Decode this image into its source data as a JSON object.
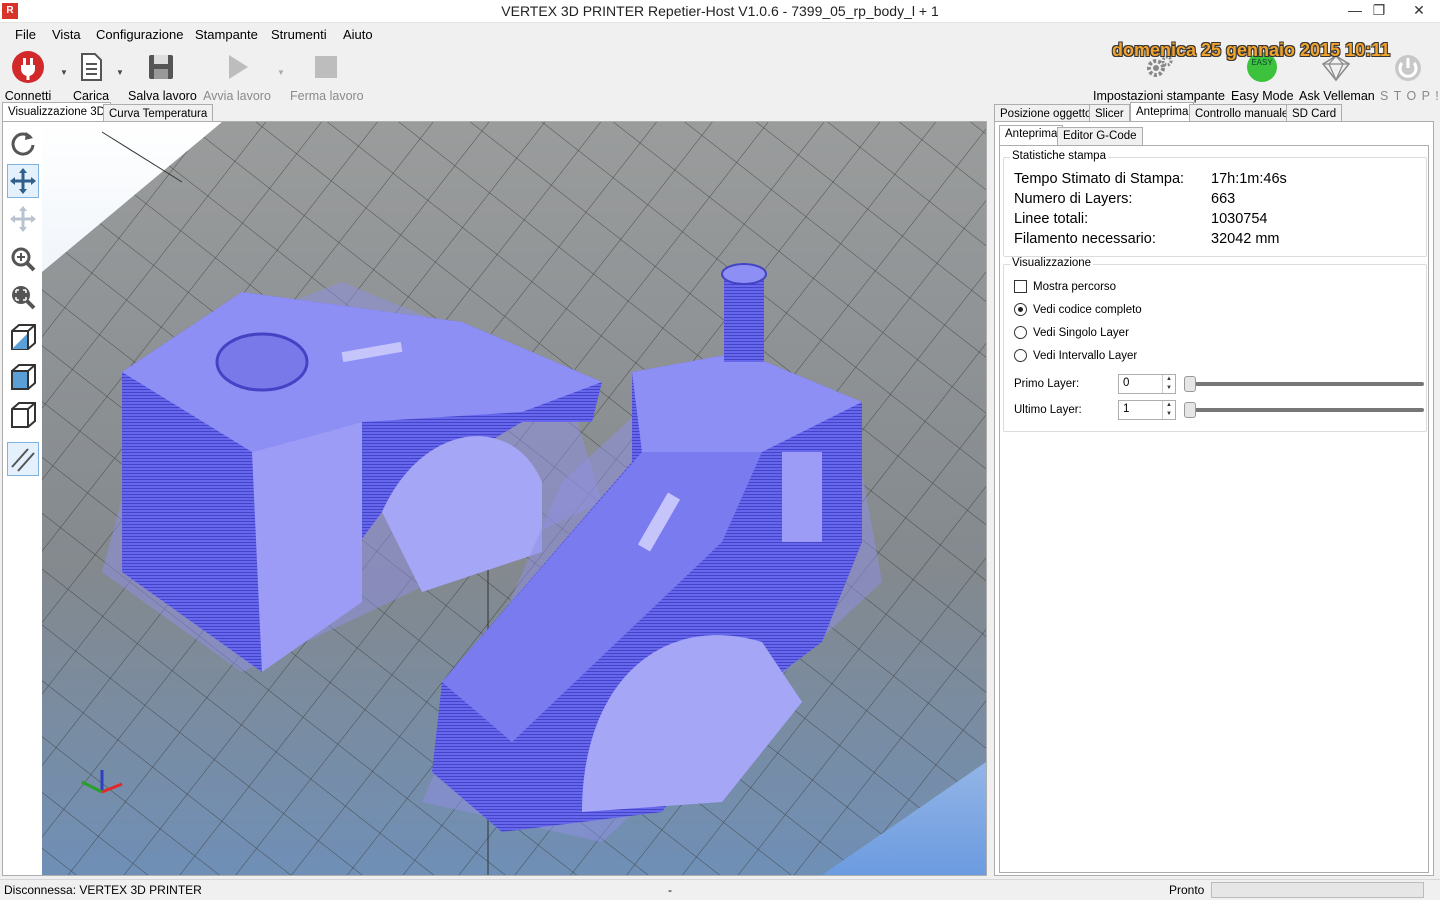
{
  "window": {
    "title": "VERTEX 3D PRINTER Repetier-Host V1.0.6 - 7399_05_rp_body_l + 1",
    "icon_text": "R",
    "minimize_icon": "minimize-icon",
    "maximize_icon": "restore-icon",
    "close_icon": "close-icon"
  },
  "menu": [
    "File",
    "Vista",
    "Configurazione",
    "Stampante",
    "Strumenti",
    "Aiuto"
  ],
  "toolbar": {
    "connect": "Connetti",
    "load": "Carica",
    "save": "Salva lavoro",
    "start": "Avvia lavoro",
    "stop_job": "Ferma lavoro",
    "printer_settings": "Impostazioni stampante",
    "easy_mode": "Easy Mode",
    "easy_badge": "EASY",
    "ask": "Ask Velleman",
    "stop": "S T O P !!!",
    "datetime": "domenica 25 gennaio 2015 10:11"
  },
  "left_tabs": [
    "Visualizzazione 3D",
    "Curva Temperatura"
  ],
  "right_tabs": [
    "Posizione oggetto",
    "Slicer",
    "Anteprima",
    "Controllo manuale",
    "SD Card"
  ],
  "preview_tabs": [
    "Anteprima",
    "Editor G-Code"
  ],
  "stats": {
    "title": "Statistiche stampa",
    "rows": [
      {
        "label": "Tempo Stimato di Stampa:",
        "value": "17h:1m:46s"
      },
      {
        "label": "Numero di Layers:",
        "value": "663"
      },
      {
        "label": "Linee totali:",
        "value": "1030754"
      },
      {
        "label": "Filamento necessario:",
        "value": "32042 mm"
      }
    ]
  },
  "visual": {
    "title": "Visualizzazione",
    "show_path": "Mostra percorso",
    "options": [
      "Vedi codice completo",
      "Vedi Singolo Layer",
      "Vedi Intervallo Layer"
    ],
    "selected_option": 0,
    "first_layer_label": "Primo Layer:",
    "first_layer_value": "0",
    "last_layer_label": "Ultimo Layer:",
    "last_layer_value": "1"
  },
  "status": {
    "left": "Disconnessa: VERTEX 3D PRINTER",
    "middle": "-",
    "right": "Pronto"
  },
  "colors": {
    "model": "#6e6ef0",
    "bed": "#8a8f94",
    "connect_red": "#d22a2a",
    "easy_green": "#3cc23c",
    "datetime": "#f2a32c"
  }
}
